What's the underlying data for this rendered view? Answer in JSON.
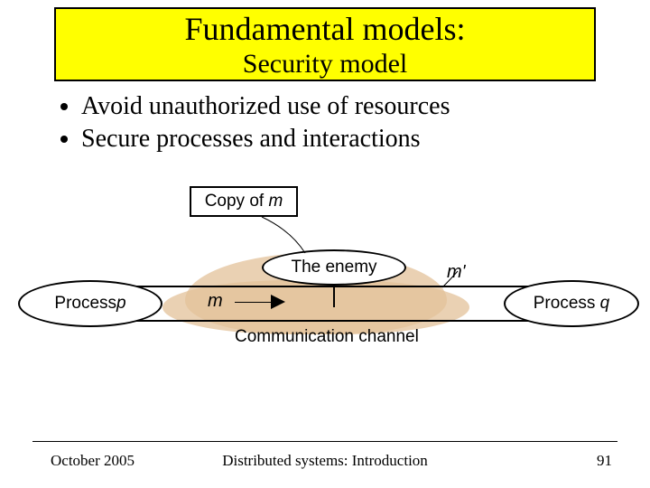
{
  "title": {
    "main": "Fundamental models:",
    "sub": "Security model"
  },
  "bullets": [
    "Avoid unauthorized use of resources",
    "Secure processes and interactions"
  ],
  "diagram": {
    "copy_box_prefix": "Copy of ",
    "copy_box_var": "m",
    "enemy_label": "The enemy",
    "process_p_prefix": "Process",
    "process_p_var": "p",
    "process_q_prefix": "Process",
    "process_q_var": "q",
    "m_label": "m",
    "m_prime_label": "m'",
    "channel_label": "Communication channel"
  },
  "footer": {
    "left": "October 2005",
    "center": "Distributed systems: Introduction",
    "right": "91"
  }
}
